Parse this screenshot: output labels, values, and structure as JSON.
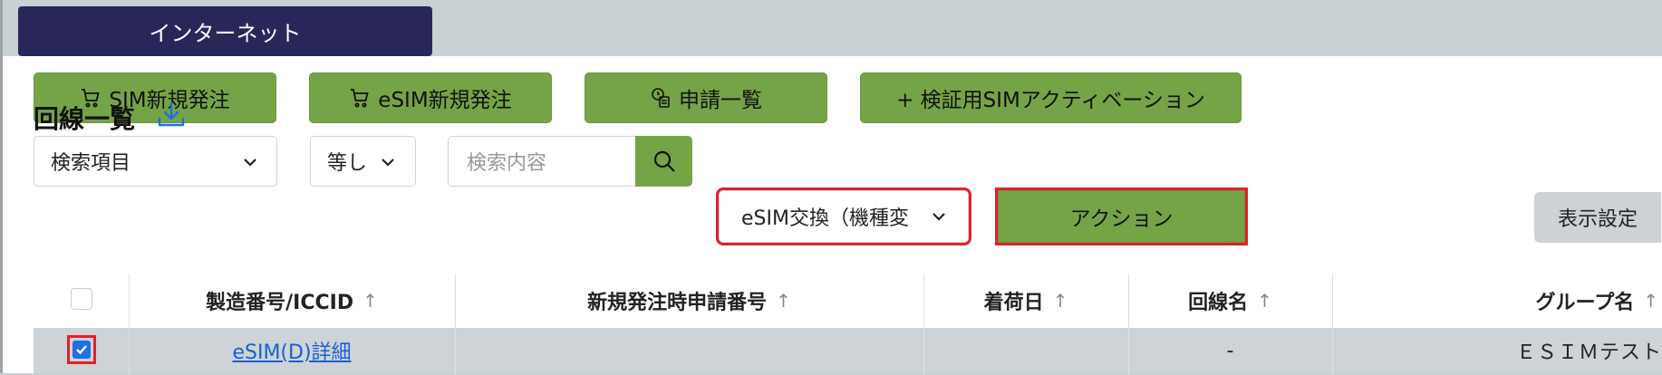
{
  "tab": {
    "label": "インターネット"
  },
  "toolbar": {
    "sim_order": "SIM新規発注",
    "esim_order": "eSIM新規発注",
    "applications": "申請一覧",
    "activation": "+ 検証用SIMアクティベーション"
  },
  "lines": {
    "title": "回線一覧",
    "search_field": "検索項目",
    "operator": "等し",
    "search_placeholder": "検索内容",
    "action_select": "eSIM交換（機種変",
    "action_button": "アクション",
    "display_settings": "表示設定"
  },
  "table": {
    "columns": [
      "製造番号/ICCID",
      "新規発注時申請番号",
      "着荷日",
      "回線名",
      "グループ名"
    ],
    "sort_symbol": "↑",
    "rows": [
      {
        "iccid": "eSIM(D)詳細",
        "order_no": "",
        "arrival": "",
        "line_name": "-",
        "group": "ＥＳＩＭテスト"
      }
    ]
  },
  "colors": {
    "accent_green": "#75a447",
    "navy": "#29275a",
    "highlight_red": "#e0202a"
  }
}
